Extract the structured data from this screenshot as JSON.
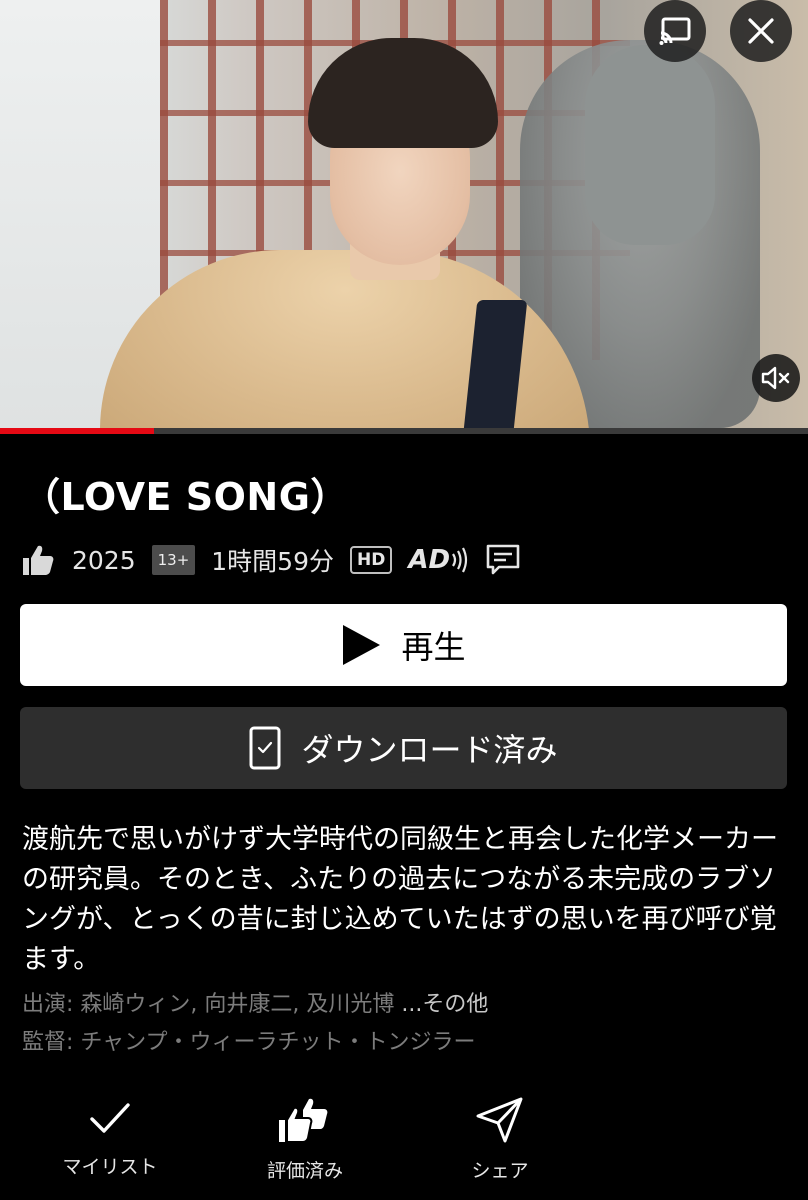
{
  "hero": {
    "cast_icon": "cast-icon",
    "close_icon": "close-icon",
    "mute_icon": "volume-muted-icon",
    "progress_fraction": 0.19,
    "progress_color": "#e50914"
  },
  "title": "（LOVE SONG）",
  "meta": {
    "rating_icon": "thumbs-up-icon",
    "year": "2025",
    "maturity": "13+",
    "duration": "1時間59分",
    "hd": "HD",
    "ad": "AD",
    "subtitles_icon": "subtitles-icon"
  },
  "buttons": {
    "play_label": "再生",
    "download_label": "ダウンロード済み"
  },
  "synopsis": "渡航先で思いがけず大学時代の同級生と再会した化学メーカーの研究員。そのとき、ふたりの過去につながる未完成のラブソングが、とっくの昔に封じ込めていたはずの思いを再び呼び覚ます。",
  "credits": {
    "cast_text": "出演: 森崎ウィン, 向井康二, 及川光博 ",
    "cast_more": "...その他",
    "director_text": "監督: チャンプ・ウィーラチット・トンジラー"
  },
  "actions": [
    {
      "label": "マイリスト",
      "icon": "check-icon"
    },
    {
      "label": "評価済み",
      "icon": "double-thumbs-up-icon"
    },
    {
      "label": "シェア",
      "icon": "send-icon"
    }
  ]
}
